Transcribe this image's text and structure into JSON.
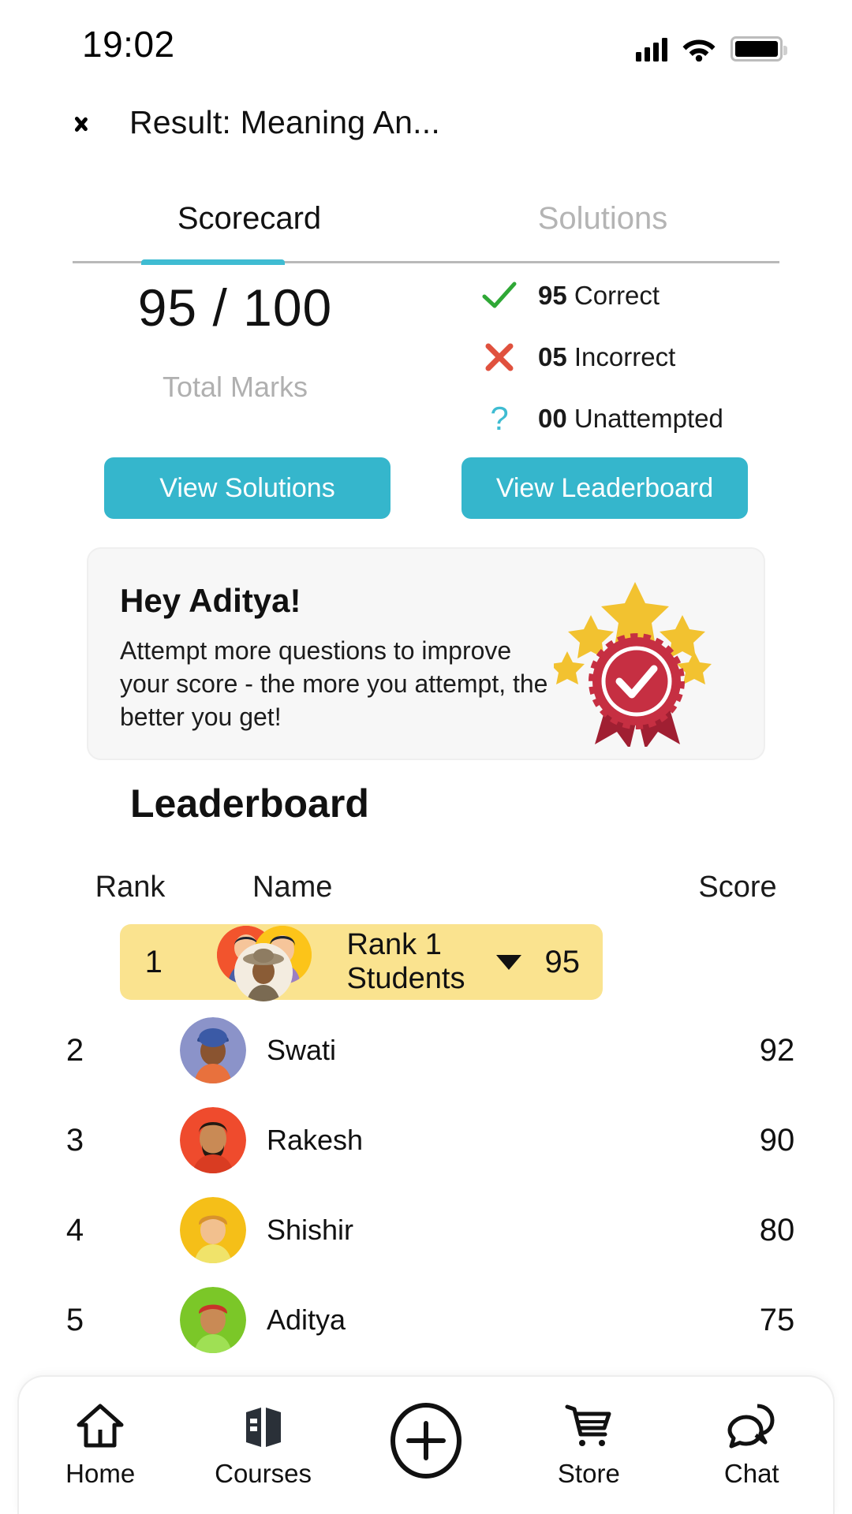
{
  "status_bar": {
    "time": "19:02",
    "signal_icon": "cellular-signal-icon",
    "wifi_icon": "wifi-icon",
    "battery_icon": "battery-full-icon"
  },
  "app_bar": {
    "back_icon": "back-chevron-icon",
    "title": "Result: Meaning An..."
  },
  "tabs": [
    {
      "label": "Scorecard",
      "active": true
    },
    {
      "label": "Solutions",
      "active": false
    }
  ],
  "score": {
    "value": "95 / 100",
    "label": "Total Marks",
    "stats": [
      {
        "icon": "green-check-icon",
        "count": "95",
        "text": "Correct",
        "color": "#2fa836"
      },
      {
        "icon": "red-cross-icon",
        "count": "05",
        "text": "Incorrect",
        "color": "#e0513e"
      },
      {
        "icon": "question-mark-icon",
        "count": "00",
        "text": "Unattempted",
        "color": "#3fbcd2"
      }
    ]
  },
  "actions": {
    "view_solutions": "View Solutions",
    "view_leaderboard": "View Leaderboard",
    "accent_color": "#35b6cc"
  },
  "promo_card": {
    "title": "Hey Aditya!",
    "body": "Attempt more questions to improve your score - the more you attempt, the better you get!",
    "badge_icon": "award-ribbon-stars-icon",
    "star_color": "#f2c230",
    "ribbon_color": "#c62f42"
  },
  "leaderboard": {
    "heading": "Leaderboard",
    "columns": {
      "rank": "Rank",
      "name": "Name",
      "score": "Score"
    },
    "highlight_color": "#fae38f",
    "rows": [
      {
        "rank": "1",
        "name": "Rank 1 Students",
        "score": "95",
        "highlight": true,
        "grouped": true,
        "dropdown_icon": "chevron-down-icon"
      },
      {
        "rank": "2",
        "name": "Swati",
        "score": "92",
        "highlight": false,
        "grouped": false,
        "avatar_color": "#8b93c9"
      },
      {
        "rank": "3",
        "name": "Rakesh",
        "score": "90",
        "highlight": false,
        "grouped": false,
        "avatar_color": "#ef4b2d"
      },
      {
        "rank": "4",
        "name": "Shishir",
        "score": "80",
        "highlight": false,
        "grouped": false,
        "avatar_color": "#f5bf18"
      },
      {
        "rank": "5",
        "name": "Aditya",
        "score": "75",
        "highlight": false,
        "grouped": false,
        "avatar_color": "#7bc728"
      }
    ]
  },
  "bottom_nav": [
    {
      "label": "Home",
      "icon": "home-icon"
    },
    {
      "label": "Courses",
      "icon": "book-icon"
    },
    {
      "label": "",
      "icon": "plus-circle-icon"
    },
    {
      "label": "Store",
      "icon": "shopping-cart-icon"
    },
    {
      "label": "Chat",
      "icon": "chat-bubble-icon"
    }
  ]
}
